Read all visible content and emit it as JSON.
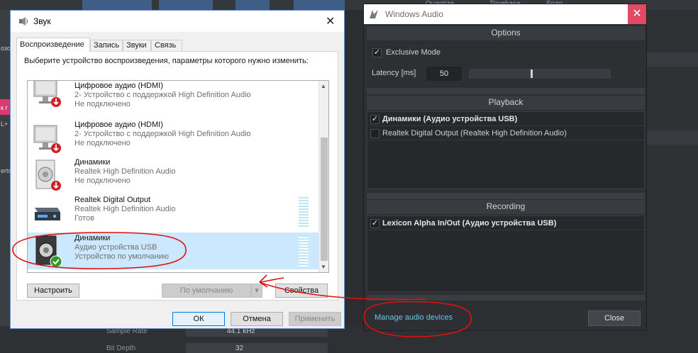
{
  "daw": {
    "top_labels": [
      "Quantize",
      "Timebase",
      "Snap"
    ],
    "left_labels": [
      "озо",
      "к г",
      "L+",
      "erts"
    ],
    "bottom_labels": [
      "Sample Rate",
      "44.1 kHz",
      "Bit Depth",
      "32"
    ]
  },
  "sound_dialog": {
    "title": "Звук",
    "close_glyph": "✕",
    "tabs": [
      {
        "label": "Воспроизведение",
        "active": true
      },
      {
        "label": "Запись",
        "active": false
      },
      {
        "label": "Звуки",
        "active": false
      },
      {
        "label": "Связь",
        "active": false
      }
    ],
    "instruction": "Выберите устройство воспроизведения, параметры которого нужно изменить:",
    "devices": [
      {
        "name": "Цифровое аудио (HDMI)",
        "desc": "2- Устройство с поддержкой High Definition Audio",
        "status": "Не подключено",
        "icon": "monitor-icon",
        "state": "disconnected"
      },
      {
        "name": "Цифровое аудио (HDMI)",
        "desc": "2- Устройство с поддержкой High Definition Audio",
        "status": "Не подключено",
        "icon": "monitor-icon",
        "state": "disconnected"
      },
      {
        "name": "Динамики",
        "desc": "Realtek High Definition Audio",
        "status": "Не подключено",
        "icon": "speaker-icon",
        "state": "disconnected"
      },
      {
        "name": "Realtek Digital Output",
        "desc": "Realtek High Definition Audio",
        "status": "Готов",
        "icon": "digital-output-icon",
        "state": "ready"
      },
      {
        "name": "Динамики",
        "desc": "Аудио устройства USB",
        "status": "Устройство по умолчанию",
        "icon": "speaker-icon",
        "state": "default"
      }
    ],
    "buttons": {
      "configure": "Настроить",
      "set_default": "По умолчанию",
      "properties": "Свойства",
      "ok": "ОК",
      "cancel": "Отмена",
      "apply": "Применить"
    }
  },
  "windows_audio": {
    "title": "Windows Audio",
    "close_glyph": "✕",
    "sections": {
      "options": "Options",
      "playback": "Playback",
      "recording": "Recording"
    },
    "exclusive_mode": {
      "label": "Exclusive Mode",
      "checked": true
    },
    "latency": {
      "label": "Latency [ms]",
      "value": "50",
      "slider_fraction": 0.44
    },
    "playback_devices": [
      {
        "label": "Динамики (Аудио устройства USB)",
        "checked": true
      },
      {
        "label": "Realtek Digital Output (Realtek High Definition Audio)",
        "checked": false
      }
    ],
    "recording_devices": [
      {
        "label": "Lexicon Alpha In/Out (Аудио устройства USB)",
        "checked": true
      }
    ],
    "manage_link": "Manage audio devices",
    "close_button": "Close"
  },
  "colors": {
    "selection": "#cce8ff",
    "annotation_red": "#e01010",
    "link": "#6cc4e8",
    "close_red": "#e04a64",
    "default_check": "#2b9a2b",
    "disconnected": "#d21f1f"
  }
}
